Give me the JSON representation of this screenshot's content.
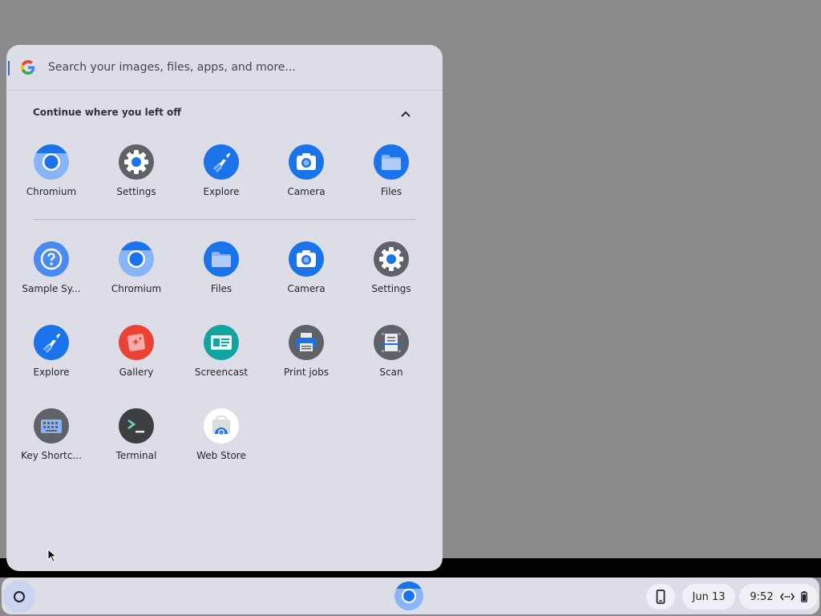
{
  "search": {
    "placeholder": "Search your images, files, apps, and more...",
    "value": ""
  },
  "continue_section": {
    "title": "Continue where you left off",
    "items": [
      {
        "label": "Chromium",
        "icon": "chromium-icon"
      },
      {
        "label": "Settings",
        "icon": "settings-icon"
      },
      {
        "label": "Explore",
        "icon": "explore-icon"
      },
      {
        "label": "Camera",
        "icon": "camera-icon"
      },
      {
        "label": "Files",
        "icon": "files-icon"
      }
    ]
  },
  "apps": [
    {
      "label": "Sample Sy...",
      "icon": "help-icon"
    },
    {
      "label": "Chromium",
      "icon": "chromium-icon"
    },
    {
      "label": "Files",
      "icon": "files-icon"
    },
    {
      "label": "Camera",
      "icon": "camera-icon"
    },
    {
      "label": "Settings",
      "icon": "settings-icon"
    },
    {
      "label": "Explore",
      "icon": "explore-icon"
    },
    {
      "label": "Gallery",
      "icon": "gallery-icon"
    },
    {
      "label": "Screencast",
      "icon": "screencast-icon"
    },
    {
      "label": "Print jobs",
      "icon": "printer-icon"
    },
    {
      "label": "Scan",
      "icon": "scan-icon"
    },
    {
      "label": "Key Shortc...",
      "icon": "keyboard-icon"
    },
    {
      "label": "Terminal",
      "icon": "terminal-icon"
    },
    {
      "label": "Web Store",
      "icon": "web-store-icon"
    }
  ],
  "shelf": {
    "date": "Jun 13",
    "time": "9:52"
  },
  "colors": {
    "accent_blue": "#1a73e8",
    "panel_bg": "#dcdde6",
    "desktop_bg": "#8a8a8c"
  }
}
